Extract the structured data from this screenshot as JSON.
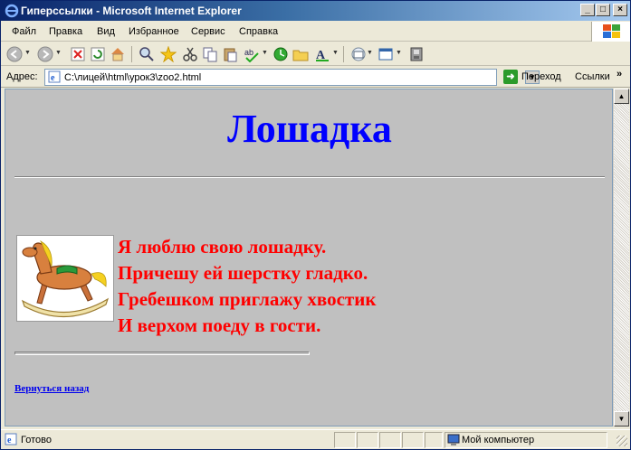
{
  "window": {
    "title": "Гиперссылки - Microsoft Internet Explorer",
    "minimize": "_",
    "maximize": "□",
    "close": "×"
  },
  "menu": {
    "items": [
      "Файл",
      "Правка",
      "Вид",
      "Избранное",
      "Сервис",
      "Справка"
    ]
  },
  "toolbar": {
    "icons": [
      "back-icon",
      "forward-icon",
      "stop-icon",
      "refresh-icon",
      "home-icon",
      "search-icon",
      "favorites-icon",
      "cut-icon",
      "copy-icon",
      "paste-icon",
      "spelling-icon",
      "history-icon",
      "folder-icon",
      "font-icon",
      "mail-icon",
      "edit-icon",
      "print-icon"
    ]
  },
  "address_bar": {
    "label": "Адрес:",
    "value": "C:\\лицей\\html\\урок3\\zoo2.html",
    "go_label": "Переход",
    "links_label": "Ссылки",
    "links_chevron": "»"
  },
  "page": {
    "title": "Лошадка",
    "image_alt": "rocking horse",
    "poem": [
      "Я люблю свою лошадку.",
      "Причешу ей шерстку гладко.",
      "Гребешком приглажу хвостик",
      "И верхом поеду в гости."
    ],
    "back_link": "Вернуться назад",
    "colors": {
      "title": "#0000ff",
      "poem": "#ff0000",
      "background": "#c0c0c0",
      "link": "#0000ee"
    }
  },
  "status_bar": {
    "text": "Готово",
    "zone": "Мой компьютер"
  }
}
